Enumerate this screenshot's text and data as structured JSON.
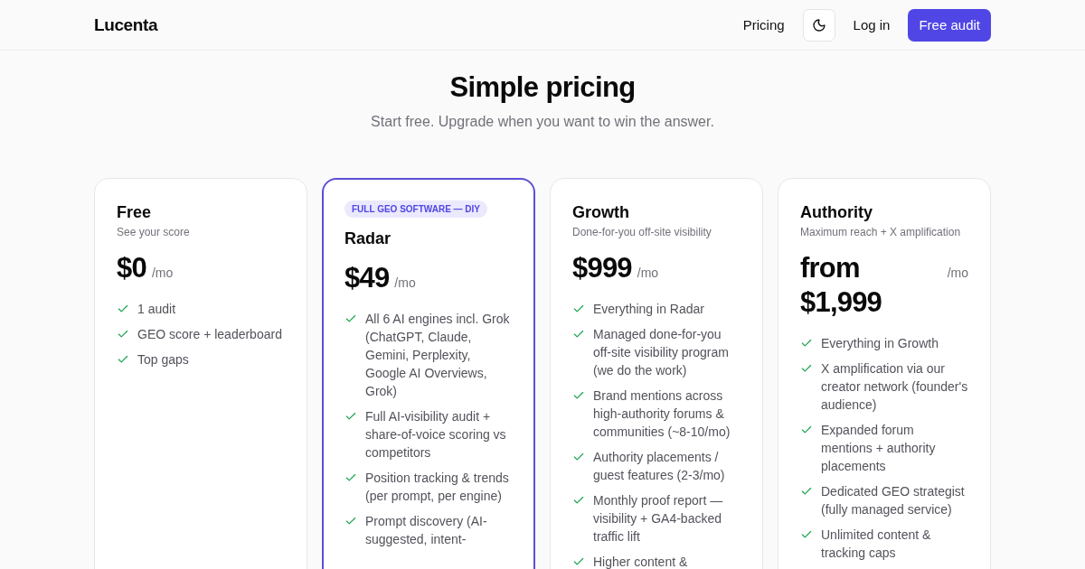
{
  "header": {
    "logo": "Lucenta",
    "nav": [
      {
        "kind": "link",
        "label": "Pricing"
      },
      {
        "kind": "theme-toggle"
      },
      {
        "kind": "link",
        "label": "Log in"
      },
      {
        "kind": "primary",
        "label": "Free audit"
      }
    ]
  },
  "hero": {
    "title": "Simple pricing",
    "subtitle": "Start free. Upgrade when you want to win the answer."
  },
  "plans": [
    {
      "name": "Free",
      "subtitle": "See your score",
      "price": "$0",
      "period": "/mo",
      "featured": false,
      "features": [
        "1 audit",
        "GEO score + leaderboard",
        "Top gaps"
      ]
    },
    {
      "badge": "FULL GEO SOFTWARE — DIY",
      "name": "Radar",
      "price": "$49",
      "period": "/mo",
      "featured": true,
      "features": [
        "All 6 AI engines incl. Grok (ChatGPT, Claude, Gemini, Perplexity, Google AI Overviews, Grok)",
        "Full AI-visibility audit + share-of-voice scoring vs competitors",
        "Position tracking & trends (per prompt, per engine)",
        "Prompt discovery (AI-suggested, intent-"
      ]
    },
    {
      "name": "Growth",
      "subtitle": "Done-for-you off-site visibility",
      "price": "$999",
      "period": "/mo",
      "featured": false,
      "features": [
        "Everything in Radar",
        "Managed done-for-you off-site visibility program (we do the work)",
        "Brand mentions across high-authority forums & communities (~8-10/mo)",
        "Authority placements / guest features (2-3/mo)",
        "Monthly proof report — visibility + GA4-backed traffic lift",
        "Higher content &"
      ]
    },
    {
      "name": "Authority",
      "subtitle": "Maximum reach + X amplification",
      "price": "from $1,999",
      "period": "/mo",
      "featured": false,
      "features": [
        "Everything in Growth",
        "X amplification via our creator network (founder's audience)",
        "Expanded forum mentions + authority placements",
        "Dedicated GEO strategist (fully managed service)",
        "Unlimited content & tracking caps"
      ]
    }
  ]
}
